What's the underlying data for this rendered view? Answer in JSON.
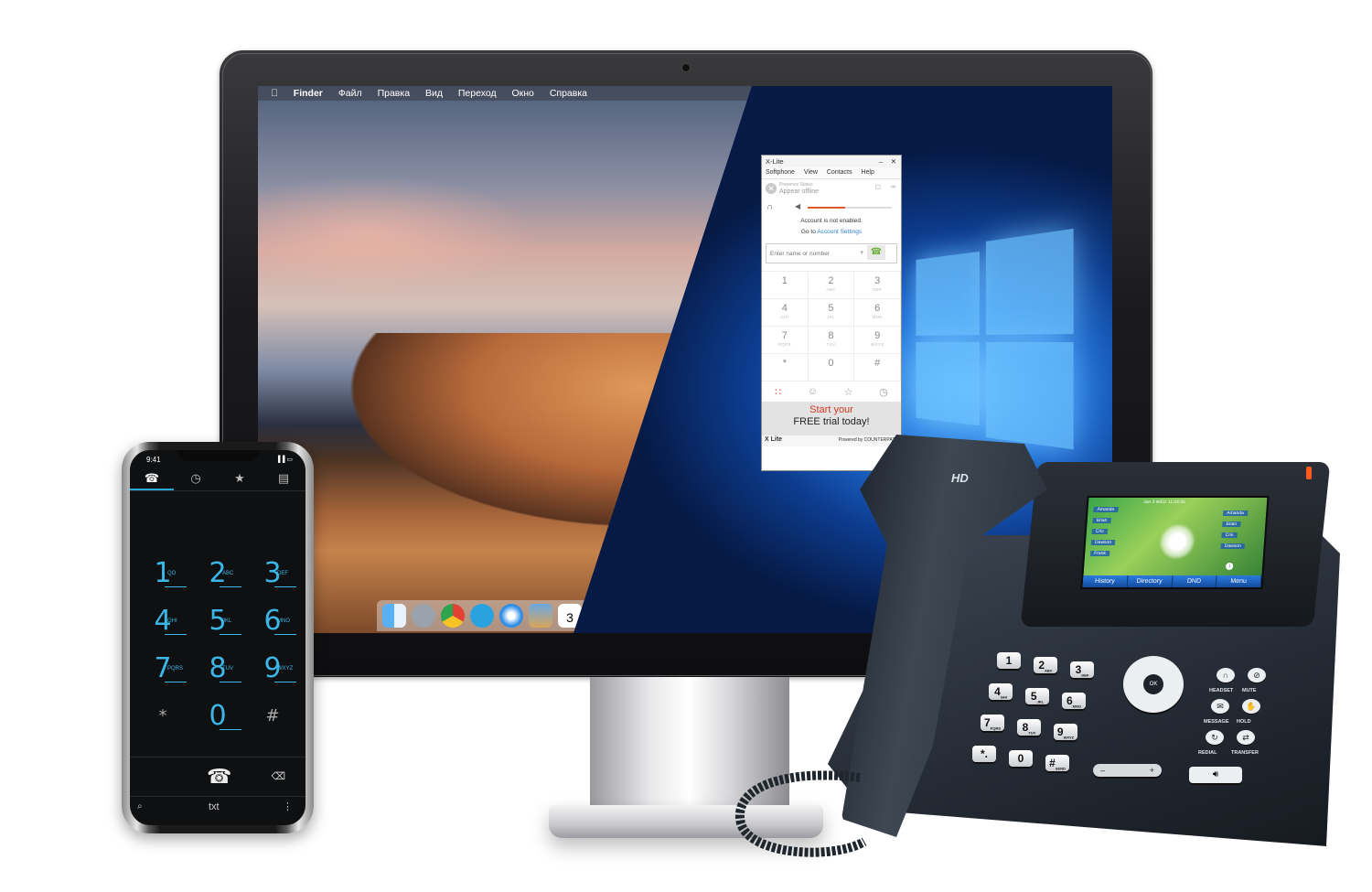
{
  "mac": {
    "menubar": {
      "apple": "",
      "app": "Finder",
      "items": [
        "Файл",
        "Правка",
        "Вид",
        "Переход",
        "Окно",
        "Справка"
      ]
    },
    "dock": {
      "icons": [
        "finder-icon",
        "launchpad-icon",
        "chrome-icon",
        "telegram-icon",
        "safari-icon",
        "preview-icon",
        "calendar-icon"
      ],
      "calendar_day": "3"
    }
  },
  "xlite": {
    "title": "X-Lite",
    "menu": [
      "Softphone",
      "View",
      "Contacts",
      "Help"
    ],
    "presence_label": "Presence Status",
    "presence_value": "Appear offline",
    "notice_line1": "Account is not enabled.",
    "notice_goto": "Go to",
    "notice_link": "Account Settings",
    "input_placeholder": "Enter name or number",
    "volume_level": 0.45,
    "keys": [
      {
        "n": "1",
        "l": ""
      },
      {
        "n": "2",
        "l": "ABC"
      },
      {
        "n": "3",
        "l": "DEF"
      },
      {
        "n": "4",
        "l": "GHI"
      },
      {
        "n": "5",
        "l": "JKL"
      },
      {
        "n": "6",
        "l": "MNO"
      },
      {
        "n": "7",
        "l": "PQRS"
      },
      {
        "n": "8",
        "l": "TUV"
      },
      {
        "n": "9",
        "l": "WXYZ"
      },
      {
        "n": "*",
        "l": ""
      },
      {
        "n": "0",
        "l": ""
      },
      {
        "n": "#",
        "l": ""
      }
    ],
    "ad_line1": "Start your",
    "ad_line2": "FREE trial today!",
    "footer_logo": "X Lite",
    "footer_powered": "Powered by COUNTERPATH"
  },
  "smartphone": {
    "time": "9:41",
    "tabs": [
      "phone-icon",
      "clock-icon",
      "star-icon",
      "contacts-icon"
    ],
    "keys": [
      [
        {
          "d": "1",
          "s": "QO"
        },
        {
          "d": "2",
          "s": "ABC"
        },
        {
          "d": "3",
          "s": "DEF"
        }
      ],
      [
        {
          "d": "4",
          "s": "GHI"
        },
        {
          "d": "5",
          "s": "JKL"
        },
        {
          "d": "6",
          "s": "MNO"
        }
      ],
      [
        {
          "d": "7",
          "s": "PQRS"
        },
        {
          "d": "8",
          "s": "TUV"
        },
        {
          "d": "9",
          "s": "WXYZ"
        }
      ],
      [
        {
          "d": "*",
          "s": ""
        },
        {
          "d": "0",
          "s": "+"
        },
        {
          "d": "#",
          "s": ""
        }
      ]
    ],
    "bottom_text": "txt"
  },
  "deskphone": {
    "brand": "HD",
    "lcd_header": "Jun 3 WED  11:24:55",
    "left_lines": [
      "Amanda",
      "Brian",
      "Cris",
      "Dawson",
      "Frank"
    ],
    "right_lines": [
      "Amanda",
      "Brian",
      "Cris",
      "Dawson"
    ],
    "page_badge": "1",
    "softkeys": [
      "History",
      "Directory",
      "DND",
      "Menu"
    ],
    "keys": [
      {
        "n": "1",
        "s": ""
      },
      {
        "n": "2",
        "s": "ABC"
      },
      {
        "n": "3",
        "s": "DEF"
      },
      {
        "n": "4",
        "s": "GHI"
      },
      {
        "n": "5",
        "s": "JKL"
      },
      {
        "n": "6",
        "s": "MNO"
      },
      {
        "n": "7",
        "s": "PQRS"
      },
      {
        "n": "8",
        "s": "TUV"
      },
      {
        "n": "9",
        "s": "WXYZ"
      },
      {
        "n": "*.",
        "s": ""
      },
      {
        "n": "0",
        "s": ""
      },
      {
        "n": "#",
        "s": "SEND"
      }
    ],
    "nav_ok": "OK",
    "labels": [
      "HEADSET",
      "MUTE",
      "MESSAGE",
      "HOLD",
      "REDIAL",
      "TRANSFER"
    ],
    "volume_minus": "–",
    "volume_plus": "+"
  }
}
